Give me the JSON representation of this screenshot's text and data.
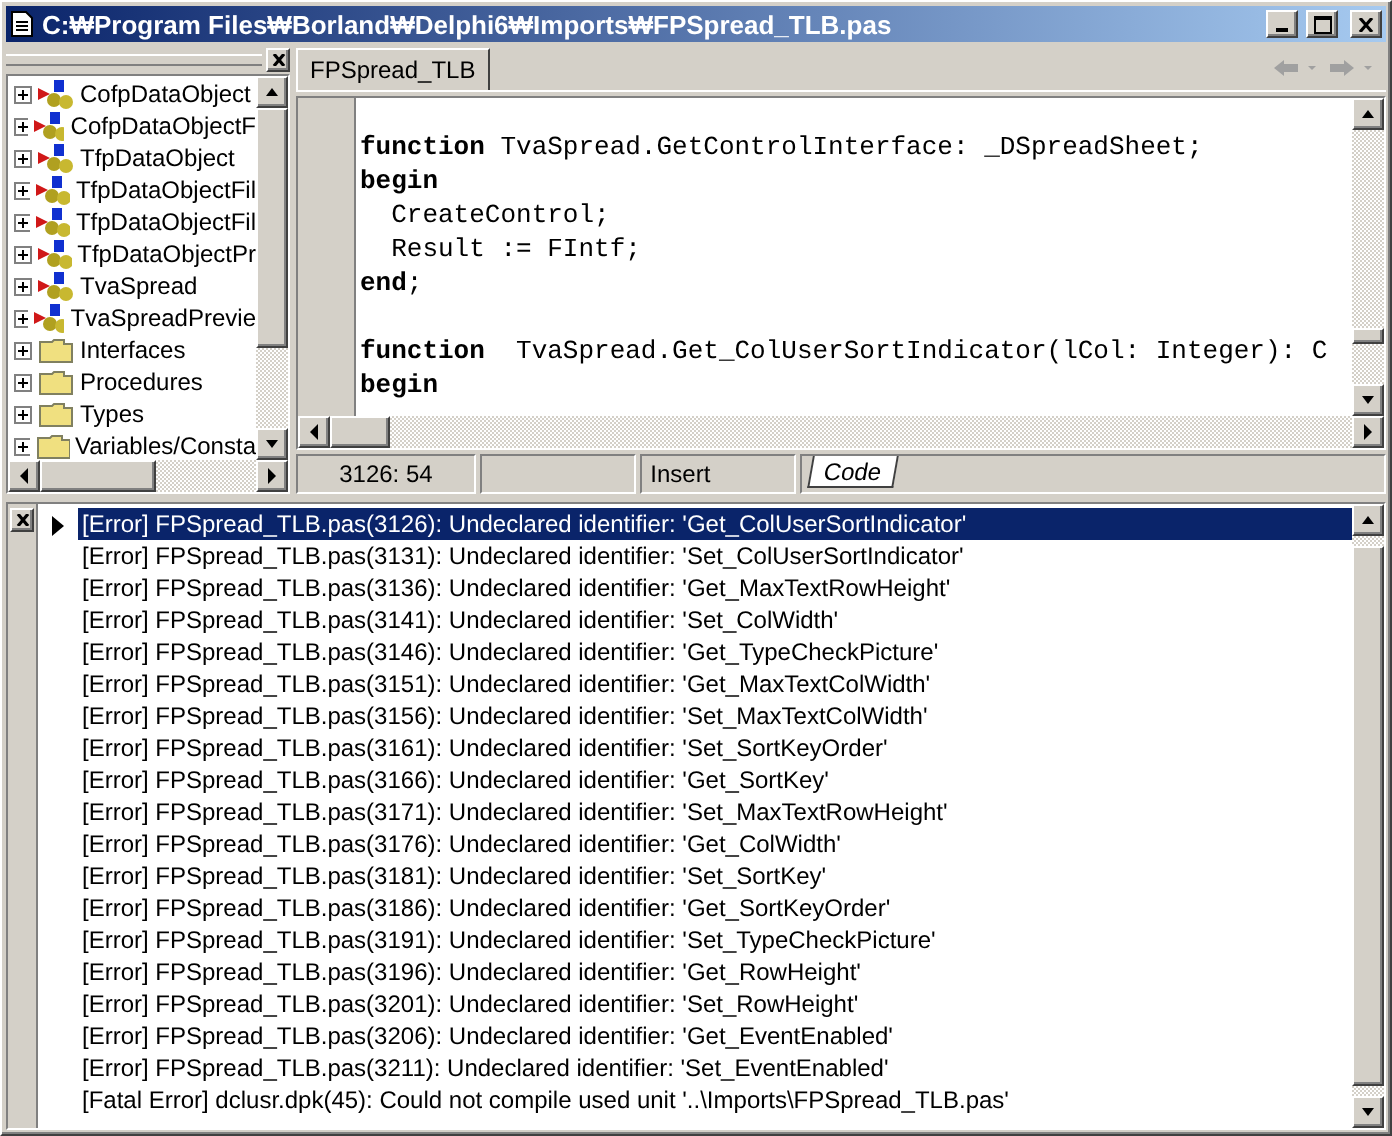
{
  "window": {
    "title": "C:₩Program Files₩Borland₩Delphi6₩Imports₩FPSpread_TLB.pas"
  },
  "explorer": {
    "items": [
      {
        "label": "CofpDataObject",
        "kind": "class",
        "expanded": false
      },
      {
        "label": "CofpDataObjectF",
        "kind": "class",
        "expanded": false
      },
      {
        "label": "TfpDataObject",
        "kind": "class",
        "expanded": false
      },
      {
        "label": "TfpDataObjectFil",
        "kind": "class",
        "expanded": false
      },
      {
        "label": "TfpDataObjectFil",
        "kind": "class",
        "expanded": false
      },
      {
        "label": "TfpDataObjectPr",
        "kind": "class",
        "expanded": false
      },
      {
        "label": "TvaSpread",
        "kind": "class",
        "expanded": false
      },
      {
        "label": "TvaSpreadPrevie",
        "kind": "class",
        "expanded": false
      },
      {
        "label": "Interfaces",
        "kind": "folder",
        "expanded": false
      },
      {
        "label": "Procedures",
        "kind": "folder",
        "expanded": false
      },
      {
        "label": "Types",
        "kind": "folder",
        "expanded": false
      },
      {
        "label": "Variables/Consta",
        "kind": "folder",
        "expanded": false
      }
    ]
  },
  "editor": {
    "tabs": [
      {
        "label": "FPSpread_TLB",
        "selected": true
      }
    ],
    "code_blocks": [
      [
        "**function** TvaSpread.GetControlInterface: _DSpreadSheet;",
        "**begin**",
        "  CreateControl;",
        "  Result := FIntf;",
        "**end**;"
      ],
      [
        "**function**  TvaSpread.Get_ColUserSortIndicator(lCol: Integer): C",
        "**begin**"
      ]
    ],
    "status": {
      "position": "3126: 54",
      "mode": "Insert",
      "view_tabs": [
        {
          "label": "Code",
          "selected": true
        }
      ]
    }
  },
  "messages": [
    {
      "text": "[Error] FPSpread_TLB.pas(3126): Undeclared identifier: 'Get_ColUserSortIndicator'",
      "selected": true
    },
    {
      "text": "[Error] FPSpread_TLB.pas(3131): Undeclared identifier: 'Set_ColUserSortIndicator'",
      "selected": false
    },
    {
      "text": "[Error] FPSpread_TLB.pas(3136): Undeclared identifier: 'Get_MaxTextRowHeight'",
      "selected": false
    },
    {
      "text": "[Error] FPSpread_TLB.pas(3141): Undeclared identifier: 'Set_ColWidth'",
      "selected": false
    },
    {
      "text": "[Error] FPSpread_TLB.pas(3146): Undeclared identifier: 'Get_TypeCheckPicture'",
      "selected": false
    },
    {
      "text": "[Error] FPSpread_TLB.pas(3151): Undeclared identifier: 'Get_MaxTextColWidth'",
      "selected": false
    },
    {
      "text": "[Error] FPSpread_TLB.pas(3156): Undeclared identifier: 'Set_MaxTextColWidth'",
      "selected": false
    },
    {
      "text": "[Error] FPSpread_TLB.pas(3161): Undeclared identifier: 'Set_SortKeyOrder'",
      "selected": false
    },
    {
      "text": "[Error] FPSpread_TLB.pas(3166): Undeclared identifier: 'Get_SortKey'",
      "selected": false
    },
    {
      "text": "[Error] FPSpread_TLB.pas(3171): Undeclared identifier: 'Set_MaxTextRowHeight'",
      "selected": false
    },
    {
      "text": "[Error] FPSpread_TLB.pas(3176): Undeclared identifier: 'Get_ColWidth'",
      "selected": false
    },
    {
      "text": "[Error] FPSpread_TLB.pas(3181): Undeclared identifier: 'Set_SortKey'",
      "selected": false
    },
    {
      "text": "[Error] FPSpread_TLB.pas(3186): Undeclared identifier: 'Get_SortKeyOrder'",
      "selected": false
    },
    {
      "text": "[Error] FPSpread_TLB.pas(3191): Undeclared identifier: 'Set_TypeCheckPicture'",
      "selected": false
    },
    {
      "text": "[Error] FPSpread_TLB.pas(3196): Undeclared identifier: 'Get_RowHeight'",
      "selected": false
    },
    {
      "text": "[Error] FPSpread_TLB.pas(3201): Undeclared identifier: 'Set_RowHeight'",
      "selected": false
    },
    {
      "text": "[Error] FPSpread_TLB.pas(3206): Undeclared identifier: 'Get_EventEnabled'",
      "selected": false
    },
    {
      "text": "[Error] FPSpread_TLB.pas(3211): Undeclared identifier: 'Set_EventEnabled'",
      "selected": false
    },
    {
      "text": "[Fatal Error] dclusr.dpk(45): Could not compile used unit '..\\Imports\\FPSpread_TLB.pas'",
      "selected": false
    }
  ]
}
